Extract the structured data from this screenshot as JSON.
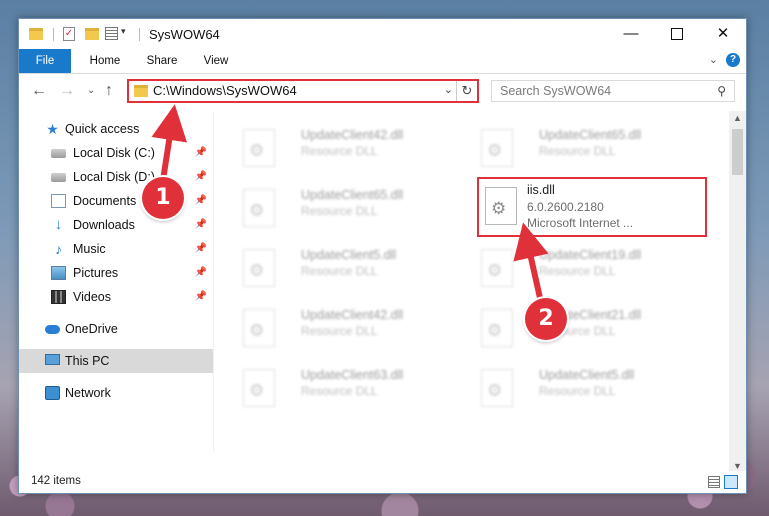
{
  "window": {
    "title": "SysWOW64",
    "minimize": "—",
    "maximize": "",
    "close": "✕"
  },
  "ribbon": {
    "tabs": [
      "File",
      "Home",
      "Share",
      "View"
    ],
    "chevron": "⌄",
    "help": "?"
  },
  "nav": {
    "back": "←",
    "forward": "→",
    "recent": "⌄",
    "up": "↑"
  },
  "address": {
    "path": "C:\\Windows\\SysWOW64",
    "dropdown": "⌄",
    "refresh": "↻"
  },
  "search": {
    "placeholder": "Search SysWOW64",
    "icon": "⚲"
  },
  "sidebar": {
    "items": [
      {
        "label": "Quick access",
        "icon": "star-icon",
        "pinned": false
      },
      {
        "label": "Local Disk (C:)",
        "icon": "drive-icon",
        "pinned": true
      },
      {
        "label": "Local Disk (D:)",
        "icon": "drive-icon",
        "pinned": true
      },
      {
        "label": "Documents",
        "icon": "documents-icon",
        "pinned": true
      },
      {
        "label": "Downloads",
        "icon": "download-icon",
        "pinned": true
      },
      {
        "label": "Music",
        "icon": "music-icon",
        "pinned": true
      },
      {
        "label": "Pictures",
        "icon": "pictures-icon",
        "pinned": true
      },
      {
        "label": "Videos",
        "icon": "videos-icon",
        "pinned": true
      },
      {
        "label": "OneDrive",
        "icon": "cloud-icon",
        "pinned": false
      },
      {
        "label": "This PC",
        "icon": "computer-icon",
        "pinned": false,
        "selected": true
      },
      {
        "label": "Network",
        "icon": "network-icon",
        "pinned": false
      }
    ],
    "pin_glyph": "📌"
  },
  "files": [
    {
      "name": "UpdateClient42.dll",
      "type": "Resource DLL",
      "faded": true
    },
    {
      "name": "UpdateClient65.dll",
      "type": "Resource DLL",
      "faded": true
    },
    {
      "name": "UpdateClient65.dll",
      "type": "Resource DLL",
      "faded": true
    },
    {
      "name": "iis.dll",
      "version": "6.0.2600.2180",
      "company": "Microsoft Internet ...",
      "faded": false,
      "highlighted": true
    },
    {
      "name": "UpdateClient5.dll",
      "type": "Resource DLL",
      "faded": true
    },
    {
      "name": "UpdateClient19.dll",
      "type": "Resource DLL",
      "faded": true
    },
    {
      "name": "UpdateClient42.dll",
      "type": "Resource DLL",
      "faded": true
    },
    {
      "name": "UpdateClient21.dll",
      "type": "Resource DLL",
      "faded": true
    },
    {
      "name": "UpdateClient63.dll",
      "type": "Resource DLL",
      "faded": true
    },
    {
      "name": "UpdateClient5.dll",
      "type": "Resource DLL",
      "faded": true
    }
  ],
  "status": {
    "item_count": "142 items"
  },
  "annotations": {
    "step1": "1",
    "step2": "2",
    "color": "#e0313b"
  }
}
